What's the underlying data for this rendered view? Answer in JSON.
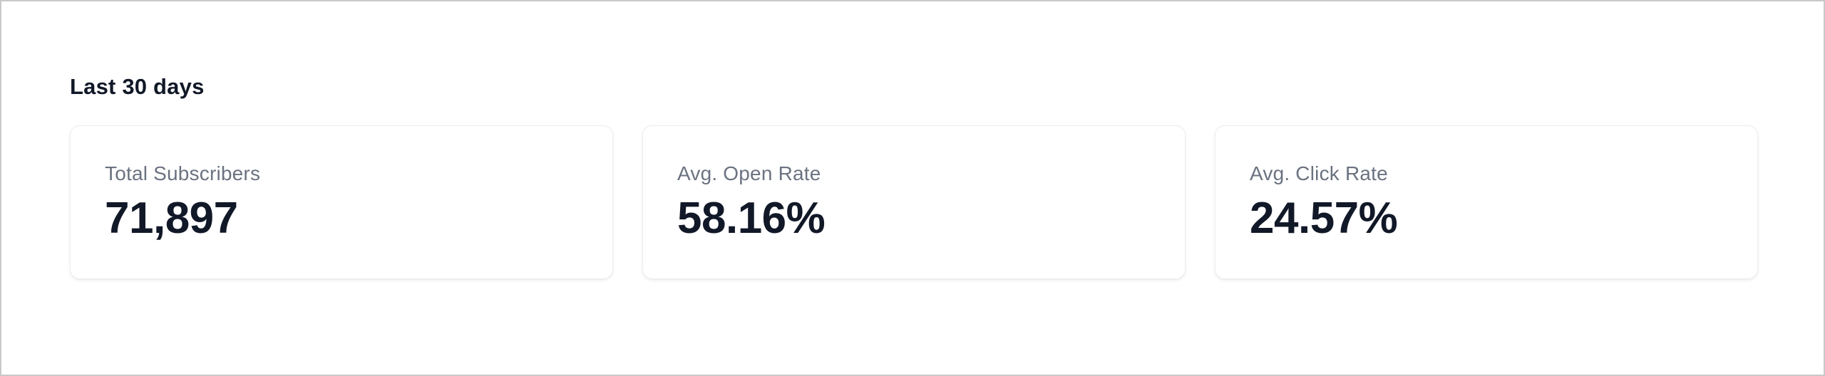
{
  "stats_section": {
    "title": "Last 30 days",
    "cards": [
      {
        "label": "Total Subscribers",
        "value": "71,897"
      },
      {
        "label": "Avg. Open Rate",
        "value": "58.16%"
      },
      {
        "label": "Avg. Click Rate",
        "value": "24.57%"
      }
    ]
  },
  "colors": {
    "text_primary": "#111827",
    "text_secondary": "#6b7280",
    "card_background": "#ffffff",
    "card_border": "#eceef2"
  }
}
